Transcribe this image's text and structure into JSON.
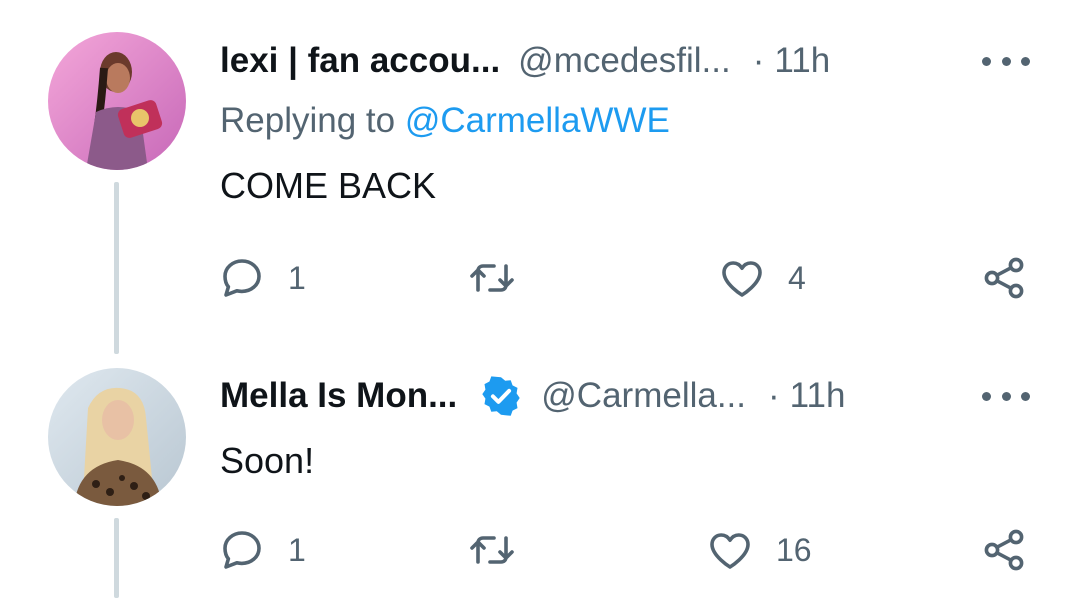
{
  "tweets": [
    {
      "display_name": "lexi | fan accou...",
      "handle": "@mcedesfil...",
      "dot": "·",
      "time": "11h",
      "verified": false,
      "replying_prefix": "Replying to",
      "replying_to": "@CarmellaWWE",
      "text": "COME BACK",
      "reply_count": "1",
      "retweet_count": "",
      "like_count": "4",
      "avatar_icon": "avatar-photo-icon"
    },
    {
      "display_name": "Mella Is Mon...",
      "handle": "@Carmella...",
      "dot": "·",
      "time": "11h",
      "verified": true,
      "text": "Soon!",
      "reply_count": "1",
      "retweet_count": "",
      "like_count": "16",
      "avatar_icon": "avatar-photo-icon"
    }
  ],
  "colors": {
    "text_primary": "#0f1419",
    "text_secondary": "#536471",
    "link": "#1d9bf0",
    "verified_badge": "#1d9bf0",
    "thread_line": "#cfd9de"
  },
  "icons": [
    "reply-icon",
    "retweet-icon",
    "like-icon",
    "share-icon",
    "more-icon",
    "verified-badge-icon"
  ]
}
